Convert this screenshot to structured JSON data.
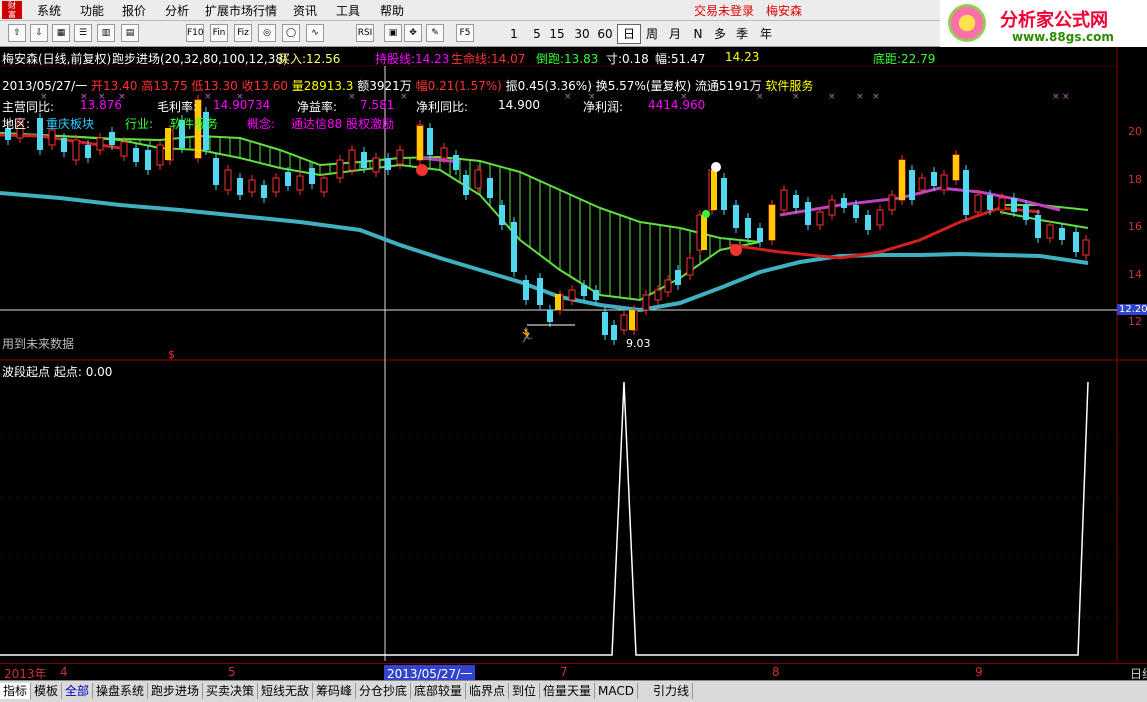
{
  "menu": {
    "logo_text": "财富\n分析",
    "items": [
      "系统",
      "功能",
      "报价",
      "分析",
      "扩展市场行情",
      "资讯",
      "工具",
      "帮助"
    ],
    "trade_status": "交易未登录",
    "stock_name": "梅安森"
  },
  "toolbar": {
    "icons": [
      "up-arrow-icon",
      "down-arrow-icon",
      "grid-icon",
      "list-icon",
      "chart-icon",
      "table-icon",
      "f10-icon",
      "fin-icon",
      "quote-icon",
      "zoom-icon",
      "circle-icon",
      "trend-icon",
      "rsi-icon",
      "book-icon",
      "move-icon",
      "pencil-icon",
      "f5-icon"
    ],
    "icon_labels": [
      "⇧",
      "⇩",
      "▦",
      "☰",
      "▥",
      "▤",
      "F10",
      "Fin",
      "Fiz",
      "◎",
      "◯",
      "∿",
      "RSI",
      "▣",
      "✥",
      "✎",
      "F5"
    ],
    "periods": [
      "1",
      "5",
      "15",
      "30",
      "60",
      "日",
      "周",
      "月",
      "N",
      "多",
      "季",
      "年"
    ],
    "active_period": "日"
  },
  "brand": {
    "name": "分析家公式网",
    "url": "www.88gs.com"
  },
  "chart_header": {
    "title": "梅安森(日线,前复权)",
    "indicator": "跑步进场(20,32,80,100,12,38)",
    "buy_label": "买入:",
    "buy_value": "12.56",
    "hold_label": "持股线:",
    "hold_value": "14.23",
    "life_label": "生命线:",
    "life_value": "14.07",
    "back_label": "倒跑:",
    "back_value": "13.83",
    "cun_label": "寸:",
    "cun_value": "0.18",
    "fu_label": "幅:",
    "fu_value": "51.47",
    "last_value": "14.23",
    "bottom_label": "底距:",
    "bottom_value": "22.79",
    "right_label": "..."
  },
  "bar_info": {
    "date": "2013/05/27/一",
    "open": "开13.40",
    "high": "高13.75",
    "low": "低13.30",
    "close": "收13.60",
    "volume": "量28913.3",
    "amount": "额3921万",
    "change": "幅0.21(1.57%)",
    "amplitude": "振0.45(3.36%)",
    "turnover": "换5.57%(量复权)",
    "float": "流通5191万",
    "sector": "软件服务"
  },
  "fundamentals": {
    "rev_yoy_label": "主营同比:",
    "rev_yoy_value": "13.876",
    "gross_margin_label": "毛利率:",
    "gross_margin_value": "14.90734",
    "net_rate_label": "净益率:",
    "net_rate_value": "7.581",
    "profit_yoy_label": "净利同比:",
    "profit_yoy_value": "14.900",
    "net_profit_label": "净利润:",
    "net_profit_value": "4414.960",
    "region_label": "地区:",
    "region_value": "重庆板块",
    "industry_label": "行业:",
    "industry_value": "软件服务",
    "concept_label": "概念:",
    "concept_value": "通达信88 股权激励"
  },
  "overlay": {
    "future_data": "用到未来数据",
    "low_price_marker": "9.03",
    "crosshair_price": "12.20"
  },
  "price_axis": [
    "20",
    "18",
    "16",
    "14",
    "12"
  ],
  "subchart": {
    "title": "波段起点",
    "label": "起点:",
    "value": "0.00"
  },
  "date_axis": {
    "year_label": "2013年",
    "months": [
      "4",
      "5",
      "7",
      "8",
      "9"
    ],
    "crosshair_date": "2013/05/27/一",
    "right_label": "日线"
  },
  "bottom_tabs": [
    "指标",
    "模板",
    "全部",
    "操盘系统",
    "跑步进场",
    "买卖决策",
    "短线无敌",
    "筹码峰",
    "分仓抄底",
    "底部较量",
    "临界点",
    "到位",
    "倍量天量",
    "MACD",
    "引力线"
  ],
  "bottom_tab_active": "指标",
  "bottom_tab_blue": "全部",
  "colors": {
    "up_candle": "#ff3030",
    "down_candle": "#50d8f0",
    "ribbon_green": "#60e040",
    "blue_line": "#40b0c0",
    "red_line": "#d02020",
    "magenta_line": "#c040c0",
    "axis_red": "#900000"
  }
}
